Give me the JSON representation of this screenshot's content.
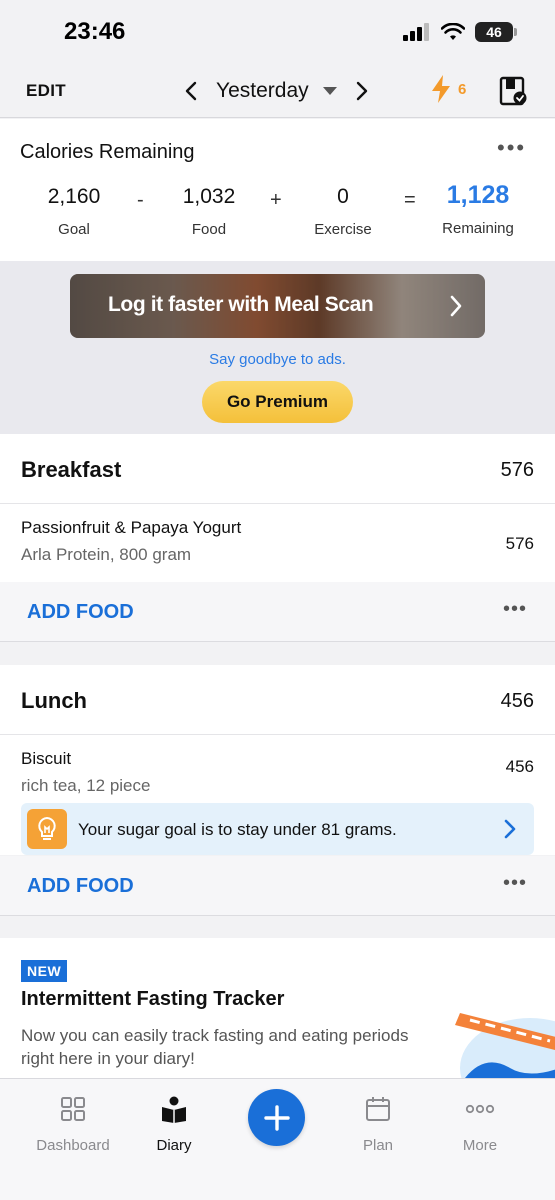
{
  "status_bar": {
    "time": "23:46",
    "battery": "46"
  },
  "top_nav": {
    "edit_label": "EDIT",
    "date_label": "Yesterday",
    "streak_count": "6"
  },
  "calories": {
    "title": "Calories Remaining",
    "goal": {
      "value": "2,160",
      "label": "Goal"
    },
    "food": {
      "value": "1,032",
      "label": "Food"
    },
    "exercise": {
      "value": "0",
      "label": "Exercise"
    },
    "remaining": {
      "value": "1,128",
      "label": "Remaining"
    },
    "op_minus": "-",
    "op_plus": "+",
    "op_equals": "="
  },
  "ad": {
    "banner_text": "Log it faster with Meal Scan",
    "tagline": "Say goodbye to ads.",
    "premium_label": "Go Premium"
  },
  "breakfast": {
    "name": "Breakfast",
    "calories": "576",
    "items": [
      {
        "name": "Passionfruit & Papaya Yogurt",
        "desc": "Arla Protein, 800 gram",
        "calories": "576"
      }
    ],
    "add_label": "ADD FOOD"
  },
  "lunch": {
    "name": "Lunch",
    "calories": "456",
    "items": [
      {
        "name": "Biscuit",
        "desc": "rich tea, 12 piece",
        "calories": "456"
      }
    ],
    "tip": "Your sugar goal is to stay under 81 grams.",
    "add_label": "ADD FOOD"
  },
  "promo": {
    "badge": "NEW",
    "title": "Intermittent Fasting Tracker",
    "desc": "Now you can easily track fasting and eating periods right here in your diary!"
  },
  "tabs": [
    {
      "label": "Dashboard",
      "icon": "dashboard-grid-icon"
    },
    {
      "label": "Diary",
      "icon": "diary-book-icon"
    },
    {
      "label": "Plan",
      "icon": "calendar-icon"
    },
    {
      "label": "More",
      "icon": "ellipsis-icon"
    }
  ],
  "colors": {
    "accent_blue": "#1a6fd8",
    "remaining_blue": "#2a7be4",
    "premium_yellow": "#f4c03a",
    "streak_orange": "#f39a2b"
  }
}
